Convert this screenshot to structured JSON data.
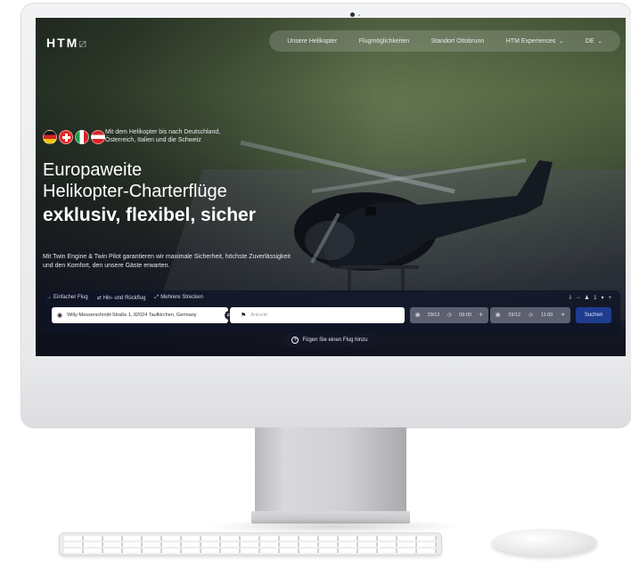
{
  "nav": {
    "logo": "HTM",
    "logo_mark": "⧄",
    "items": [
      {
        "label": "Unsere Helikopter"
      },
      {
        "label": "Flugmöglichkeiten"
      },
      {
        "label": "Standort Ottobrunn"
      },
      {
        "label": "HTM Experiences",
        "dropdown": true
      },
      {
        "label": "DE",
        "dropdown": true
      }
    ]
  },
  "hero": {
    "flag_note": "Mit dem Helikopter bis nach Deutschland, Österreich, Italien und die Schweiz",
    "headline_line1": "Europaweite",
    "headline_line2": "Helikopter-Charterflüge",
    "headline_line3": "exklusiv, flexibel, sicher",
    "subtext": "Mit Twin Engine & Twin Pilot garantieren wir maximale Sicherheit, höchste Zuverlässigkeit und den Komfort, den unsere Gäste erwarten.",
    "flags": [
      "de",
      "ch",
      "it",
      "at"
    ]
  },
  "booking": {
    "tabs": [
      {
        "icon": "→",
        "label": "Einfacher Flug"
      },
      {
        "icon": "⇄",
        "label": "Hin- und Rückflug"
      },
      {
        "icon": "⤢",
        "label": "Mehrere Strecken"
      }
    ],
    "passengers": {
      "person_icon": "♟",
      "count": "1"
    },
    "from_value": "Willy-Messerschmitt-Straße 1, 82024 Taufkirchen, Germany",
    "to_placeholder": "Ankunft",
    "date_a": {
      "date": "29/12",
      "time": "09:00"
    },
    "date_b": {
      "date": "29/12",
      "time": "11:00"
    },
    "search_label": "Suchen",
    "add_flight_label": "Fügen Sie einen Flug hinzu"
  },
  "colors": {
    "accent": "#1f3c8f",
    "panel": "#10142a"
  }
}
